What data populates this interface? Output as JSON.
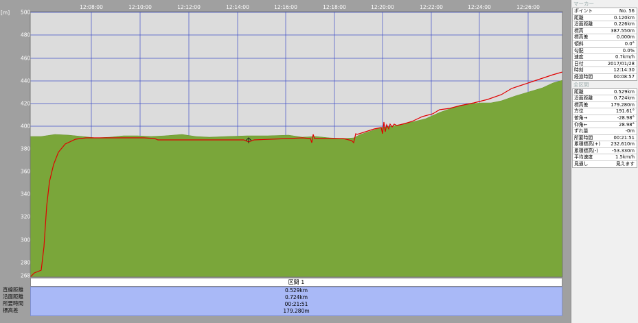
{
  "chart": {
    "unit_label": "[m]",
    "x_ticks": [
      "12:08:00",
      "12:10:00",
      "12:12:00",
      "12:14:00",
      "12:16:00",
      "12:18:00",
      "12:20:00",
      "12:22:00",
      "12:24:00",
      "12:26:00"
    ],
    "y_ticks": [
      "500",
      "480",
      "460",
      "440",
      "420",
      "400",
      "380",
      "360",
      "340",
      "320",
      "300",
      "280",
      "268"
    ],
    "colors": {
      "background": "#dcdcdc",
      "grid": "#4050c8",
      "terrain": "#7aa63a",
      "route": "#e00000"
    }
  },
  "section": {
    "header": "区間 1",
    "labels": [
      "直線距離",
      "沿面距離",
      "所要時間",
      "標高差"
    ],
    "values": [
      "0.529km",
      "0.724km",
      "00:21:51",
      "179.280m"
    ]
  },
  "marker": {
    "title": "マーカー",
    "rows": [
      {
        "key": "ポイント",
        "value": "No. 56"
      },
      {
        "key": "距離",
        "value": "0.120km"
      },
      {
        "key": "沿面距離",
        "value": "0.226km"
      },
      {
        "key": "標高",
        "value": "387.550m"
      },
      {
        "key": "標高差",
        "value": "0.000m"
      },
      {
        "key": "傾斜",
        "value": "0.0°"
      },
      {
        "key": "勾配",
        "value": "0.0%"
      },
      {
        "key": "速度",
        "value": "0.7km/h"
      },
      {
        "key": "日付",
        "value": "2017/01/28"
      },
      {
        "key": "時刻",
        "value": "12:14:30"
      },
      {
        "key": "経過時間",
        "value": "00:08:57"
      }
    ]
  },
  "overall": {
    "title": "全区間",
    "rows": [
      {
        "key": "距離",
        "value": "0.529km"
      },
      {
        "key": "沿面距離",
        "value": "0.724km"
      },
      {
        "key": "標高差",
        "value": "179.280m"
      },
      {
        "key": "方位",
        "value": "191.61°"
      },
      {
        "key": "俯角→",
        "value": "-28.98°"
      },
      {
        "key": "仰角←",
        "value": "28.98°"
      },
      {
        "key": "ずれ量",
        "value": "-0m"
      },
      {
        "key": "所要時間",
        "value": "00:21:51"
      },
      {
        "key": "累積標高(+)",
        "value": "232.610m"
      },
      {
        "key": "累積標高(-)",
        "value": "-53.330m"
      },
      {
        "key": "平均速度",
        "value": "1.5km/h"
      },
      {
        "key": "見通し",
        "value": "見えます"
      }
    ]
  }
}
